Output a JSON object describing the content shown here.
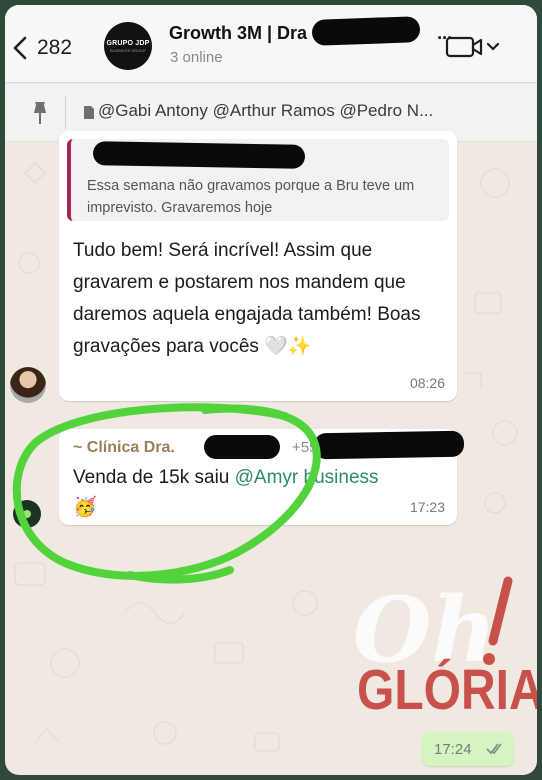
{
  "header": {
    "back_count": "282",
    "avatar_text": "GRUPO JDP",
    "avatar_subtext": "BUSINESS GROUP",
    "title": "Growth 3M | Dra",
    "title_suffix": "...",
    "subtitle": "3 online"
  },
  "pinned": {
    "text": "@Gabi Antony @Arthur Ramos @Pedro N..."
  },
  "messages": [
    {
      "quote_text": "Essa semana não gravamos porque a Bru teve um imprevisto. Gravaremos hoje",
      "text": "Tudo bem! Será incrível! Assim que gravarem e postarem nos mandem que daremos aquela engajada também! Boas gravações para vocês 🤍✨",
      "time": "08:26"
    },
    {
      "sender": "~ Clínica Dra.",
      "phone": "+55",
      "text_before": "Venda de 15k saiu ",
      "mention": "@Amyr business",
      "text_after": " 🥳",
      "time": "17:23"
    },
    {
      "time": "17:24"
    }
  ],
  "watermark": {
    "oh": "Oh!",
    "gloria": "GLÓRIA"
  },
  "colors": {
    "accent_circle": "#52d33c",
    "quote_bar": "#a3265b",
    "mention": "#2b8a6f",
    "outgoing_bubble": "#d5f5c0",
    "gloria": "#c9514c"
  }
}
